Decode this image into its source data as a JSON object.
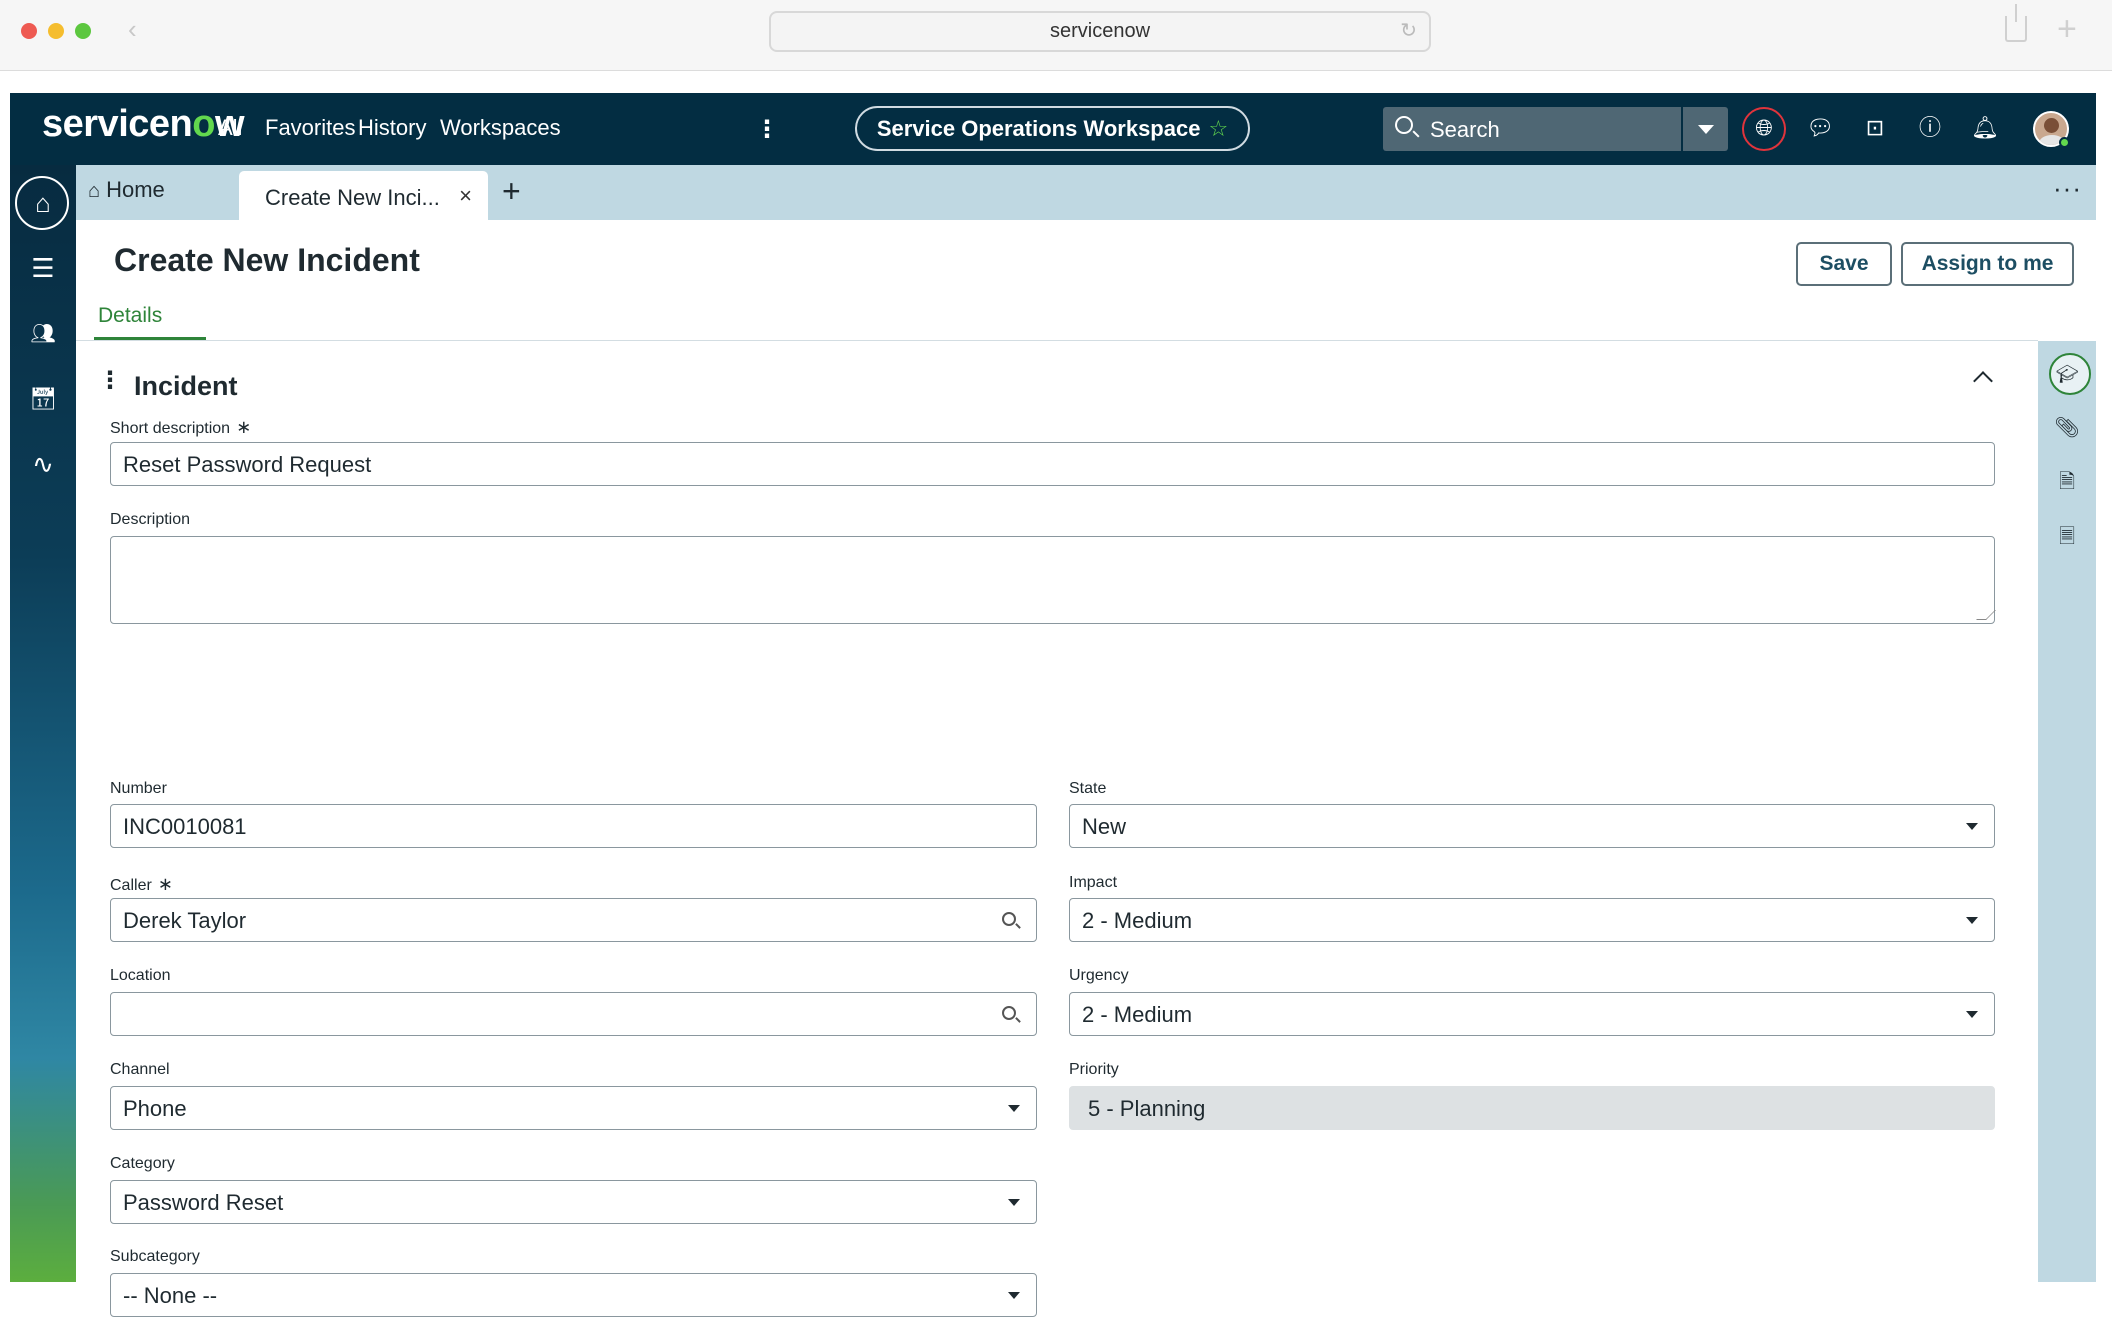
{
  "browser": {
    "url": "servicenow"
  },
  "header": {
    "logo_prefix": "servicen",
    "logo_o": "o",
    "logo_suffix": "w",
    "nav": [
      "All",
      "Favorites",
      "History",
      "Workspaces"
    ],
    "workspace": "Service Operations Workspace",
    "search_placeholder": "Search"
  },
  "tabs": {
    "home": "Home",
    "active": "Create New Inci..."
  },
  "page": {
    "title": "Create New Incident",
    "save_label": "Save",
    "assign_label": "Assign to me",
    "details_tab": "Details",
    "section_title": "Incident"
  },
  "form": {
    "short_description": {
      "label": "Short description",
      "required": "∗",
      "value": "Reset Password Request"
    },
    "description": {
      "label": "Description",
      "value": ""
    },
    "number": {
      "label": "Number",
      "value": "INC0010081"
    },
    "state": {
      "label": "State",
      "value": "New"
    },
    "caller": {
      "label": "Caller",
      "required": "∗",
      "value": "Derek Taylor"
    },
    "impact": {
      "label": "Impact",
      "value": "2 - Medium"
    },
    "location": {
      "label": "Location",
      "value": ""
    },
    "urgency": {
      "label": "Urgency",
      "value": "2 - Medium"
    },
    "channel": {
      "label": "Channel",
      "value": "Phone"
    },
    "priority": {
      "label": "Priority",
      "value": "5 - Planning"
    },
    "category": {
      "label": "Category",
      "value": "Password Reset"
    },
    "subcategory": {
      "label": "Subcategory",
      "value": "-- None --"
    }
  },
  "colors": {
    "nav_bg": "#032d42",
    "accent_green": "#2e8439",
    "tab_bar": "#bfd8e2",
    "alert_red": "#e0343c"
  }
}
